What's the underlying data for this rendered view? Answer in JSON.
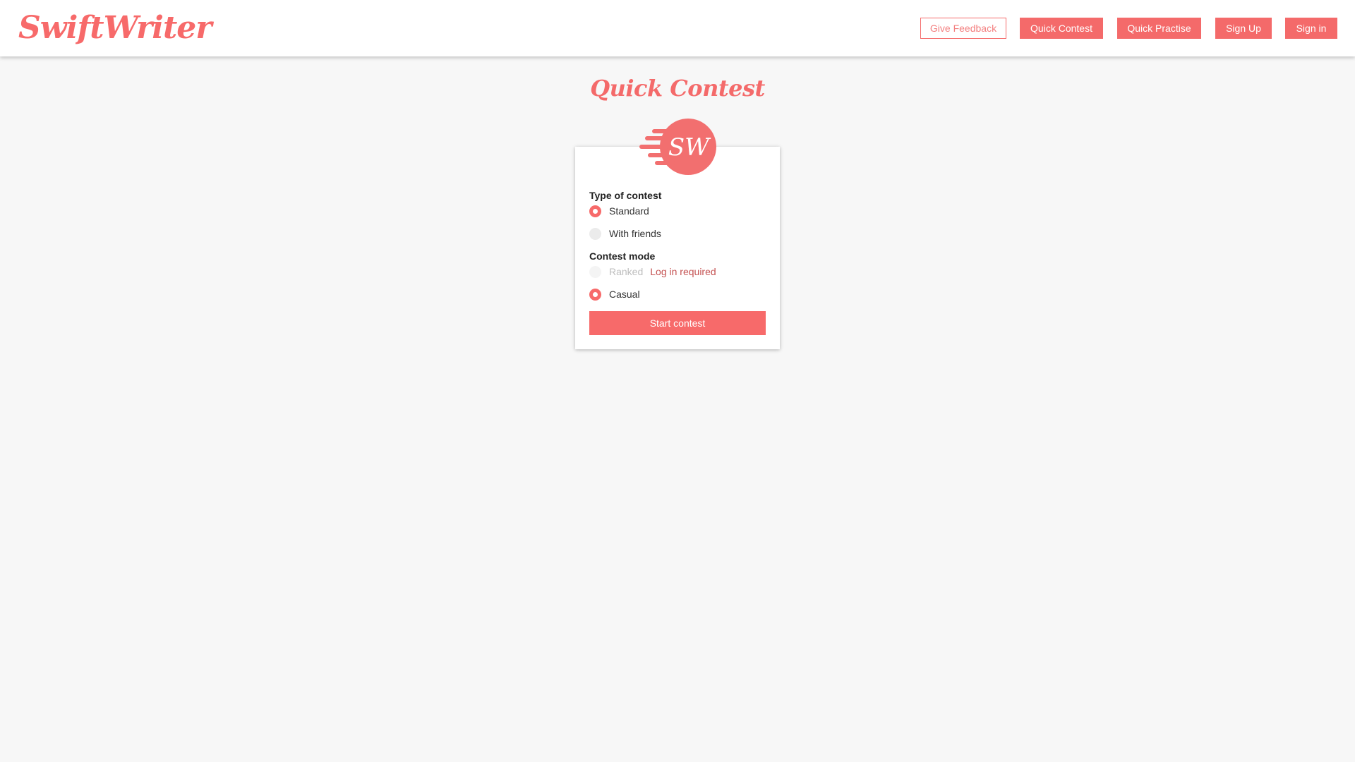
{
  "header": {
    "brand": "SwiftWriter",
    "nav": {
      "give_feedback": "Give Feedback",
      "quick_contest": "Quick Contest",
      "quick_practise": "Quick Practise",
      "sign_up": "Sign Up",
      "sign_in": "Sign in"
    }
  },
  "main": {
    "title": "Quick Contest",
    "logo": {
      "icon": "sw-speed-logo-icon",
      "text": "SW"
    },
    "form": {
      "type_label": "Type of contest",
      "type_options": [
        {
          "label": "Standard",
          "checked": true
        },
        {
          "label": "With friends",
          "checked": false
        }
      ],
      "mode_label": "Contest mode",
      "mode_options": [
        {
          "label": "Ranked",
          "checked": false,
          "disabled": true,
          "note": "Log in required"
        },
        {
          "label": "Casual",
          "checked": true
        }
      ],
      "submit_label": "Start contest"
    }
  },
  "colors": {
    "accent": "#f76a6a",
    "background": "#f7f7f7",
    "warning_text": "#c45151"
  }
}
